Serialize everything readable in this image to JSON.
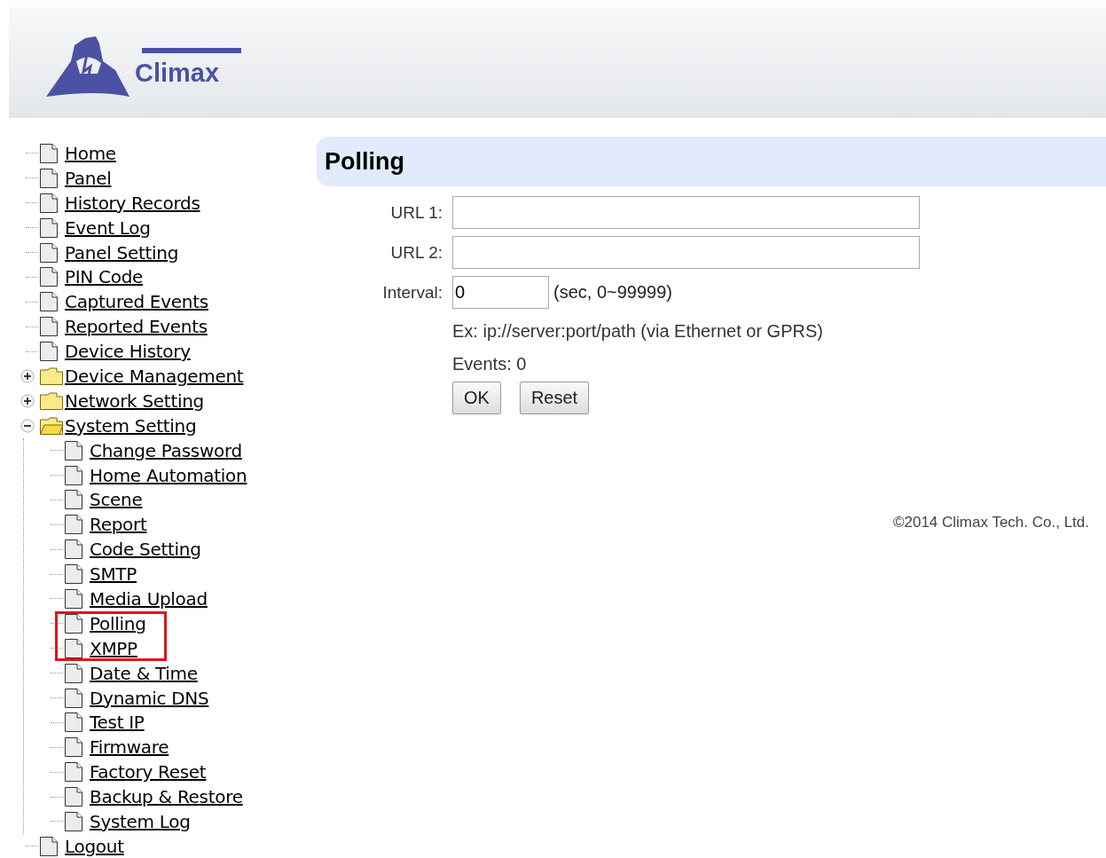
{
  "header": {
    "logo_text": "Climax"
  },
  "nav_tree": [
    {
      "label": "Home",
      "kind": "page",
      "highlighted": false
    },
    {
      "label": "Panel",
      "kind": "page",
      "highlighted": false
    },
    {
      "label": "History Records",
      "kind": "page",
      "highlighted": false
    },
    {
      "label": "Event Log",
      "kind": "page",
      "highlighted": false
    },
    {
      "label": "Panel Setting",
      "kind": "page",
      "highlighted": false
    },
    {
      "label": "PIN Code",
      "kind": "page",
      "highlighted": false
    },
    {
      "label": "Captured Events",
      "kind": "page",
      "highlighted": false
    },
    {
      "label": "Reported Events",
      "kind": "page",
      "highlighted": false
    },
    {
      "label": "Device History",
      "kind": "page",
      "highlighted": false
    },
    {
      "label": "Device Management",
      "kind": "folder",
      "expanded": false,
      "highlighted": false
    },
    {
      "label": "Network Setting",
      "kind": "folder",
      "expanded": false,
      "highlighted": false
    },
    {
      "label": "System Setting",
      "kind": "folder",
      "expanded": true,
      "highlighted": false,
      "children": [
        {
          "label": "Change Password",
          "kind": "page",
          "highlighted": false
        },
        {
          "label": "Home Automation",
          "kind": "page",
          "highlighted": false
        },
        {
          "label": "Scene",
          "kind": "page",
          "highlighted": false
        },
        {
          "label": "Report",
          "kind": "page",
          "highlighted": false
        },
        {
          "label": "Code Setting",
          "kind": "page",
          "highlighted": false
        },
        {
          "label": "SMTP",
          "kind": "page",
          "highlighted": false
        },
        {
          "label": "Media Upload",
          "kind": "page",
          "highlighted": false
        },
        {
          "label": "Polling",
          "kind": "page",
          "highlighted": true
        },
        {
          "label": "XMPP",
          "kind": "page",
          "highlighted": true
        },
        {
          "label": "Date & Time",
          "kind": "page",
          "highlighted": false
        },
        {
          "label": "Dynamic DNS",
          "kind": "page",
          "highlighted": false
        },
        {
          "label": "Test IP",
          "kind": "page",
          "highlighted": false
        },
        {
          "label": "Firmware",
          "kind": "page",
          "highlighted": false
        },
        {
          "label": "Factory Reset",
          "kind": "page",
          "highlighted": false
        },
        {
          "label": "Backup & Restore",
          "kind": "page",
          "highlighted": false
        },
        {
          "label": "System Log",
          "kind": "page",
          "highlighted": false
        }
      ]
    },
    {
      "label": "Logout",
      "kind": "page",
      "highlighted": false
    }
  ],
  "panel": {
    "title": "Polling",
    "fields": [
      {
        "label": "URL 1:",
        "kind": "wide"
      },
      {
        "label": "URL 2:",
        "kind": "wide"
      },
      {
        "label": "Interval:",
        "kind": "short",
        "value": "0",
        "suffix": "(sec, 0~99999)"
      }
    ],
    "hint": "Ex: ip://server:port/path (via Ethernet or GPRS)",
    "events": "Events: 0",
    "buttons": [
      "OK",
      "Reset"
    ],
    "footer": "©2014 Climax Tech. Co., Ltd."
  }
}
